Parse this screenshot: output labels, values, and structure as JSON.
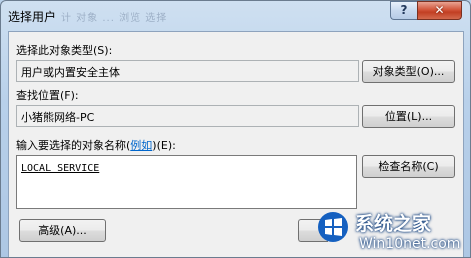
{
  "window": {
    "title": "选择用户",
    "title_ghost": "计  对象 ... 浏览  选择",
    "help_label": "?",
    "close_label": "✕"
  },
  "object_type": {
    "label": "选择此对象类型(S):",
    "value": "用户或内置安全主体",
    "button": "对象类型(O)..."
  },
  "location": {
    "label": "查找位置(F):",
    "value": "小猪熊网络-PC",
    "button": "位置(L)..."
  },
  "names": {
    "label_prefix": "输入要选择的对象名称(",
    "label_link": "例如",
    "label_suffix": ")(E):",
    "value": "LOCAL SERVICE",
    "check_button": "检查名称(C)"
  },
  "footer": {
    "advanced_button": "高级(A)..."
  },
  "watermark": {
    "line1": "系统之家",
    "line2": "Win10net.com"
  },
  "colors": {
    "title_gradient_top": "#cfe0f1",
    "client_bg": "#f0f0f0",
    "link": "#0066cc",
    "close_red": "#c23f23",
    "watermark_blue": "#1560c0"
  }
}
